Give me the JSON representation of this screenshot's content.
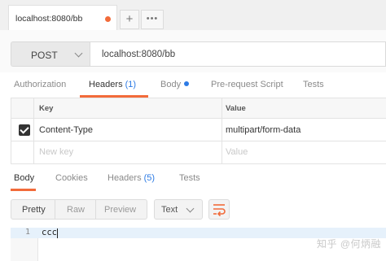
{
  "request_tab": {
    "label": "localhost:8080/bb",
    "unsaved_color": "#f26b3a"
  },
  "tabstrip": {
    "new_tab_icon": "plus-icon",
    "more_icon": "ellipsis-icon"
  },
  "request": {
    "method": "POST",
    "url": "localhost:8080/bb"
  },
  "request_tabs": [
    {
      "label": "Authorization",
      "active": false
    },
    {
      "label": "Headers",
      "count": "(1)",
      "active": true
    },
    {
      "label": "Body",
      "indicator": "blue-dot",
      "active": false
    },
    {
      "label": "Pre-request Script",
      "active": false
    },
    {
      "label": "Tests",
      "active": false
    }
  ],
  "headers_table": {
    "columns": {
      "key": "Key",
      "value": "Value"
    },
    "rows": [
      {
        "checked": true,
        "key": "Content-Type",
        "value": "multipart/form-data"
      }
    ],
    "new_row": {
      "key_placeholder": "New key",
      "value_placeholder": "Value"
    }
  },
  "response_tabs": [
    {
      "label": "Body",
      "active": true
    },
    {
      "label": "Cookies",
      "active": false
    },
    {
      "label": "Headers",
      "count": "(5)",
      "active": false
    },
    {
      "label": "Tests",
      "active": false
    }
  ],
  "view_modes": [
    {
      "label": "Pretty",
      "active": true
    },
    {
      "label": "Raw",
      "active": false
    },
    {
      "label": "Preview",
      "active": false
    }
  ],
  "format": {
    "selected": "Text"
  },
  "wrap_icon": "wrap-lines-icon",
  "editor": {
    "lines": [
      {
        "number": "1",
        "text": "ccc"
      }
    ]
  },
  "watermark": "知乎 @何炳融",
  "colors": {
    "accent": "#f26b3a",
    "link": "#2d7be5",
    "line_highlight": "#e6f1fb"
  }
}
